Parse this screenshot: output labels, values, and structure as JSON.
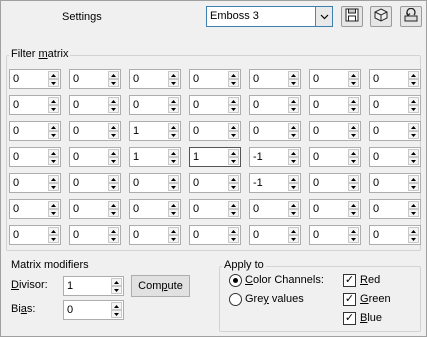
{
  "header": {
    "settings_label": "Settings",
    "preset": "Emboss 3"
  },
  "toolbar": {
    "icons": [
      "save-icon",
      "cube-icon",
      "reset-icon"
    ]
  },
  "filter_matrix": {
    "title_pre": "Filter ",
    "title_ul": "m",
    "title_post": "atrix",
    "rows": [
      [
        "0",
        "0",
        "0",
        "0",
        "0",
        "0",
        "0"
      ],
      [
        "0",
        "0",
        "0",
        "0",
        "0",
        "0",
        "0"
      ],
      [
        "0",
        "0",
        "1",
        "0",
        "0",
        "0",
        "0"
      ],
      [
        "0",
        "0",
        "1",
        "1",
        "-1",
        "0",
        "0"
      ],
      [
        "0",
        "0",
        "0",
        "0",
        "-1",
        "0",
        "0"
      ],
      [
        "0",
        "0",
        "0",
        "0",
        "0",
        "0",
        "0"
      ],
      [
        "0",
        "0",
        "0",
        "0",
        "0",
        "0",
        "0"
      ]
    ]
  },
  "modifiers": {
    "title": "Matrix modifiers",
    "divisor_label_ul": "D",
    "divisor_label_rest": "ivisor:",
    "divisor_value": "1",
    "bias_label_pre": "Bi",
    "bias_label_ul": "a",
    "bias_label_post": "s:",
    "bias_value": "0",
    "compute_pre": "Com",
    "compute_ul": "p",
    "compute_post": "ute"
  },
  "apply_to": {
    "title": "Apply to",
    "color_channels_ul": "C",
    "color_channels_rest": "olor Channels:",
    "grey_pre": "Gre",
    "grey_ul": "y",
    "grey_post": " values",
    "red_ul": "R",
    "red_rest": "ed",
    "green_ul": "G",
    "green_rest": "reen",
    "blue_ul": "B",
    "blue_rest": "lue"
  }
}
